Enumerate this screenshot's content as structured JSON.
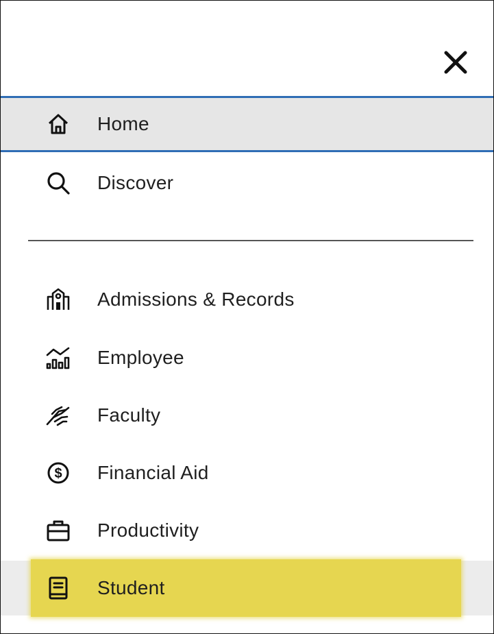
{
  "menu": {
    "close_icon": "close-icon",
    "primary": [
      {
        "label": "Home",
        "icon": "home-icon"
      },
      {
        "label": "Discover",
        "icon": "search-icon"
      }
    ],
    "categories": [
      {
        "label": "Admissions & Records",
        "icon": "building-icon"
      },
      {
        "label": "Employee",
        "icon": "chart-icon"
      },
      {
        "label": "Faculty",
        "icon": "handshake-icon"
      },
      {
        "label": "Financial Aid",
        "icon": "dollar-circle-icon"
      },
      {
        "label": "Productivity",
        "icon": "briefcase-icon"
      },
      {
        "label": "Student",
        "icon": "book-icon"
      }
    ],
    "selected": "Home",
    "highlighted": "Student"
  },
  "colors": {
    "selected_border": "#2f6db5",
    "selected_background": "#e6e6e6",
    "highlight": "#e6d650"
  }
}
